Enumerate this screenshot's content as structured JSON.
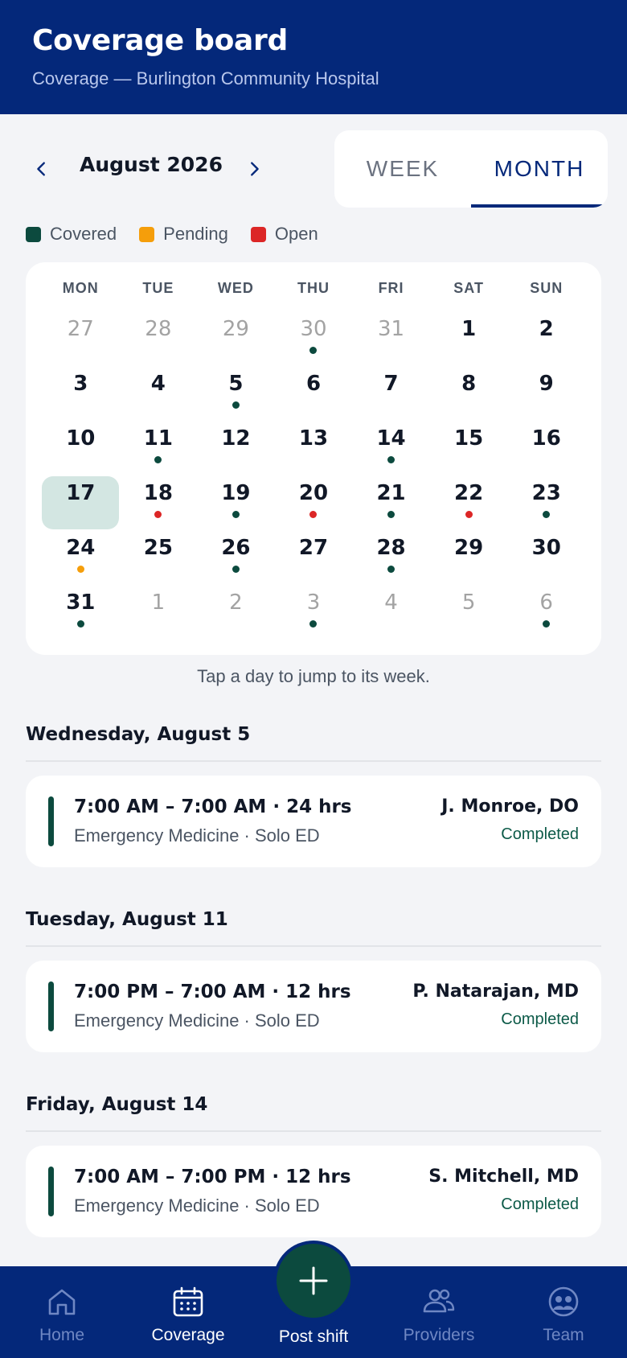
{
  "header": {
    "title": "Coverage board",
    "subtitle": "Coverage — Burlington Community Hospital"
  },
  "month_nav": {
    "label": "August 2026",
    "prev_icon": "chevron-left-icon",
    "next_icon": "chevron-right-icon"
  },
  "view_toggle": {
    "options": [
      "WEEK",
      "MONTH"
    ],
    "selected": "MONTH"
  },
  "legend": [
    {
      "label": "Covered",
      "color": "#0c4a3e"
    },
    {
      "label": "Pending",
      "color": "#f59e0b"
    },
    {
      "label": "Open",
      "color": "#dc2626"
    }
  ],
  "status_colors": {
    "covered": "#0c4a3e",
    "pending": "#f59e0b",
    "open": "#dc2626"
  },
  "calendar": {
    "weekdays": [
      "MON",
      "TUE",
      "WED",
      "THU",
      "FRI",
      "SAT",
      "SUN"
    ],
    "selected_day": "17",
    "weeks": [
      [
        {
          "day": "27",
          "other": true,
          "status": null
        },
        {
          "day": "28",
          "other": true,
          "status": null
        },
        {
          "day": "29",
          "other": true,
          "status": null
        },
        {
          "day": "30",
          "other": true,
          "status": "covered"
        },
        {
          "day": "31",
          "other": true,
          "status": null
        },
        {
          "day": "1",
          "other": false,
          "status": null
        },
        {
          "day": "2",
          "other": false,
          "status": null
        }
      ],
      [
        {
          "day": "3",
          "other": false,
          "status": null
        },
        {
          "day": "4",
          "other": false,
          "status": null
        },
        {
          "day": "5",
          "other": false,
          "status": "covered"
        },
        {
          "day": "6",
          "other": false,
          "status": null
        },
        {
          "day": "7",
          "other": false,
          "status": null
        },
        {
          "day": "8",
          "other": false,
          "status": null
        },
        {
          "day": "9",
          "other": false,
          "status": null
        }
      ],
      [
        {
          "day": "10",
          "other": false,
          "status": null
        },
        {
          "day": "11",
          "other": false,
          "status": "covered"
        },
        {
          "day": "12",
          "other": false,
          "status": null
        },
        {
          "day": "13",
          "other": false,
          "status": null
        },
        {
          "day": "14",
          "other": false,
          "status": "covered"
        },
        {
          "day": "15",
          "other": false,
          "status": null
        },
        {
          "day": "16",
          "other": false,
          "status": null
        }
      ],
      [
        {
          "day": "17",
          "other": false,
          "status": null,
          "selected": true
        },
        {
          "day": "18",
          "other": false,
          "status": "open"
        },
        {
          "day": "19",
          "other": false,
          "status": "covered"
        },
        {
          "day": "20",
          "other": false,
          "status": "open"
        },
        {
          "day": "21",
          "other": false,
          "status": "covered"
        },
        {
          "day": "22",
          "other": false,
          "status": "open"
        },
        {
          "day": "23",
          "other": false,
          "status": "covered"
        }
      ],
      [
        {
          "day": "24",
          "other": false,
          "status": "pending"
        },
        {
          "day": "25",
          "other": false,
          "status": null
        },
        {
          "day": "26",
          "other": false,
          "status": "covered"
        },
        {
          "day": "27",
          "other": false,
          "status": null
        },
        {
          "day": "28",
          "other": false,
          "status": "covered"
        },
        {
          "day": "29",
          "other": false,
          "status": null
        },
        {
          "day": "30",
          "other": false,
          "status": null
        }
      ],
      [
        {
          "day": "31",
          "other": false,
          "status": "covered"
        },
        {
          "day": "1",
          "other": true,
          "status": null
        },
        {
          "day": "2",
          "other": true,
          "status": null
        },
        {
          "day": "3",
          "other": true,
          "status": "covered"
        },
        {
          "day": "4",
          "other": true,
          "status": null
        },
        {
          "day": "5",
          "other": true,
          "status": null
        },
        {
          "day": "6",
          "other": true,
          "status": "covered"
        }
      ]
    ]
  },
  "hint": "Tap a day to jump to its week.",
  "shift_groups": [
    {
      "date": "Wednesday, August 5",
      "shift": {
        "time": "7:00 AM – 7:00 AM · 24 hrs",
        "department": "Emergency Medicine · Solo ED",
        "provider": "J. Monroe, DO",
        "status": "Completed"
      }
    },
    {
      "date": "Tuesday, August 11",
      "shift": {
        "time": "7:00 PM – 7:00 AM · 12 hrs",
        "department": "Emergency Medicine · Solo ED",
        "provider": "P. Natarajan, MD",
        "status": "Completed"
      }
    },
    {
      "date": "Friday, August 14",
      "shift": {
        "time": "7:00 AM – 7:00 PM · 12 hrs",
        "department": "Emergency Medicine · Solo ED",
        "provider": "S. Mitchell, MD",
        "status": "Completed"
      }
    }
  ],
  "bottom_nav": {
    "items": [
      {
        "label": "Home",
        "icon": "home-icon",
        "active": false
      },
      {
        "label": "Coverage",
        "icon": "calendar-icon",
        "active": true
      },
      {
        "label": "Providers",
        "icon": "people-icon",
        "active": false
      },
      {
        "label": "Team",
        "icon": "team-icon",
        "active": false
      }
    ],
    "fab": {
      "label": "Post shift",
      "icon": "plus-icon"
    }
  }
}
